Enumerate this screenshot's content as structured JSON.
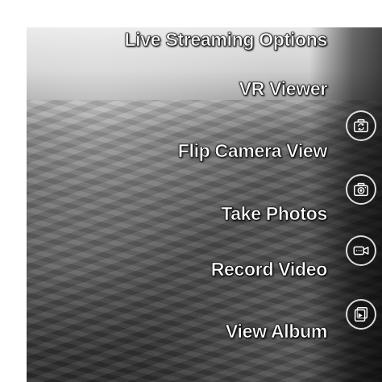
{
  "menu": {
    "live_streaming": "Live Streaming Options",
    "vr_viewer": "VR Viewer",
    "flip_camera": "Flip Camera View",
    "take_photos": "Take Photos",
    "record_video": "Record Video",
    "view_album": "View Album"
  },
  "icons": {
    "flip": "flip-camera-icon",
    "photo": "camera-icon",
    "video": "video-camera-icon",
    "album": "album-icon"
  }
}
